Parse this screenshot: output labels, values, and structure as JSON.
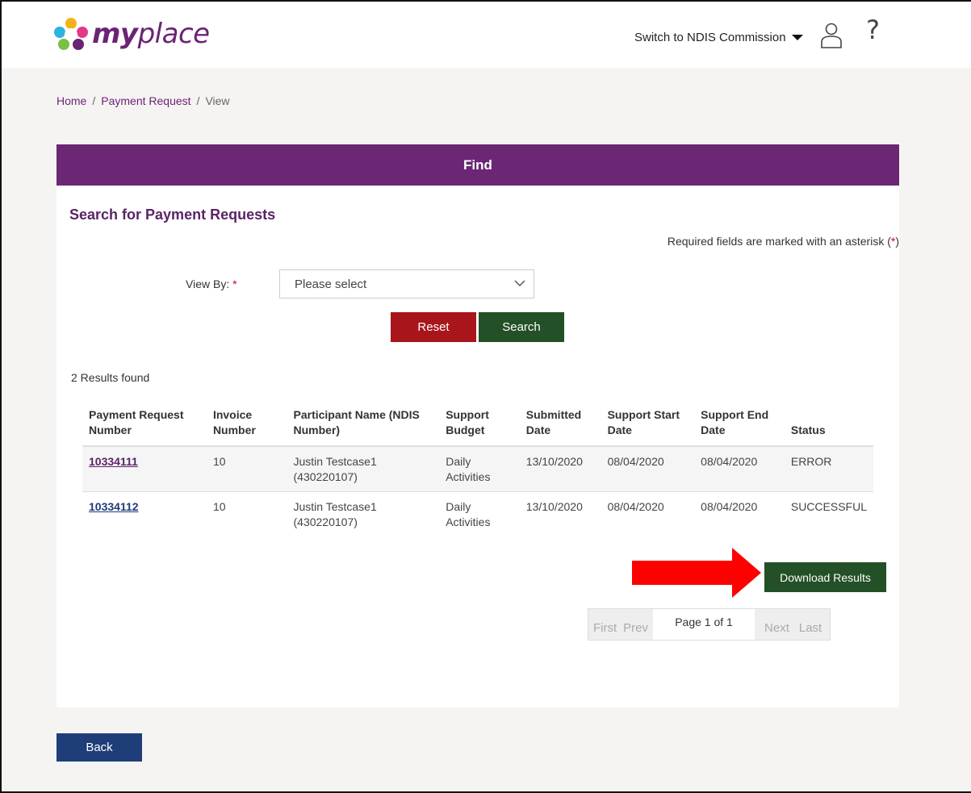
{
  "header": {
    "logo_my": "my",
    "logo_place": "place",
    "switch_label": "Switch to NDIS Commission",
    "help_glyph": "?"
  },
  "breadcrumb": [
    "Home",
    "Payment Request",
    "View"
  ],
  "find_panel": {
    "title": "Find",
    "section_title": "Search for Payment Requests",
    "required_note": "Required fields are marked with an asterisk (",
    "required_star": "*",
    "required_close": ")",
    "view_by_label": "View By:",
    "view_by_value": "Please select",
    "reset_label": "Reset",
    "search_label": "Search"
  },
  "results": {
    "count_text": "2 Results found",
    "columns": [
      [
        "Payment Request",
        "Number"
      ],
      [
        "Invoice",
        "Number"
      ],
      [
        "Participant Name (NDIS",
        "Number)"
      ],
      [
        "Support",
        "Budget"
      ],
      [
        "Submitted",
        "Date"
      ],
      [
        "Support Start",
        "Date"
      ],
      [
        "Support End",
        "Date"
      ],
      [
        "",
        "Status"
      ]
    ],
    "rows": [
      {
        "request_number": "10334111",
        "invoice": "10",
        "participant_name": "Justin Testcase1",
        "ndis_number": "(430220107)",
        "budget_1": "Daily",
        "budget_2": "Activities",
        "submitted": "13/10/2020",
        "start": "08/04/2020",
        "end": "08/04/2020",
        "status": "ERROR"
      },
      {
        "request_number": "10334112",
        "invoice": "10",
        "participant_name": "Justin Testcase1",
        "ndis_number": "(430220107)",
        "budget_1": "Daily",
        "budget_2": "Activities",
        "submitted": "13/10/2020",
        "start": "08/04/2020",
        "end": "08/04/2020",
        "status": "SUCCESSFUL"
      }
    ],
    "download_label": "Download Results",
    "pager": {
      "first": "First",
      "prev": "Prev",
      "info": "Page 1 of 1",
      "next": "Next",
      "last": "Last"
    }
  },
  "back_label": "Back",
  "colors": {
    "brand_purple": "#6b2674",
    "reset_red": "#a8161b",
    "action_green": "#235026",
    "back_blue": "#1f3d78",
    "annotation_arrow": "#ff0000"
  },
  "icons": [
    "logo-icon",
    "caret-down-icon",
    "user-icon",
    "help-icon",
    "chevron-down-icon",
    "red-arrow-annotation"
  ]
}
